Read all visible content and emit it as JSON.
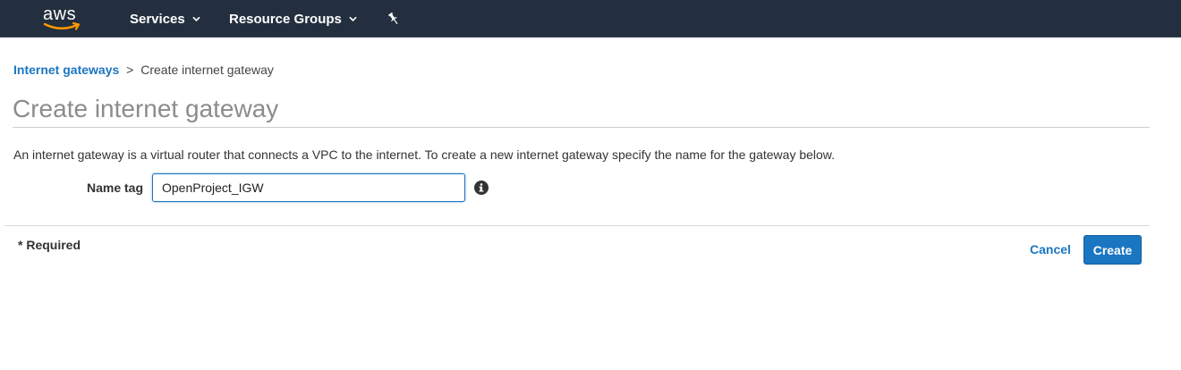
{
  "topnav": {
    "logo_text": "aws",
    "services_label": "Services",
    "resource_groups_label": "Resource Groups",
    "background_color": "#232f3e",
    "logo_smile_color": "#ff9900"
  },
  "breadcrumb": {
    "parent_label": "Internet gateways",
    "separator": ">",
    "current_label": "Create internet gateway"
  },
  "page": {
    "title": "Create internet gateway",
    "description": "An internet gateway is a virtual router that connects a VPC to the internet. To create a new internet gateway specify the name for the gateway below."
  },
  "form": {
    "name_tag_label": "Name tag",
    "name_tag_value": "OpenProject_IGW",
    "info_icon": "info-icon"
  },
  "footer": {
    "required_note": "* Required",
    "cancel_label": "Cancel",
    "create_label": "Create"
  },
  "colors": {
    "accent": "#1b76c2",
    "title": "#8c8c8c"
  }
}
